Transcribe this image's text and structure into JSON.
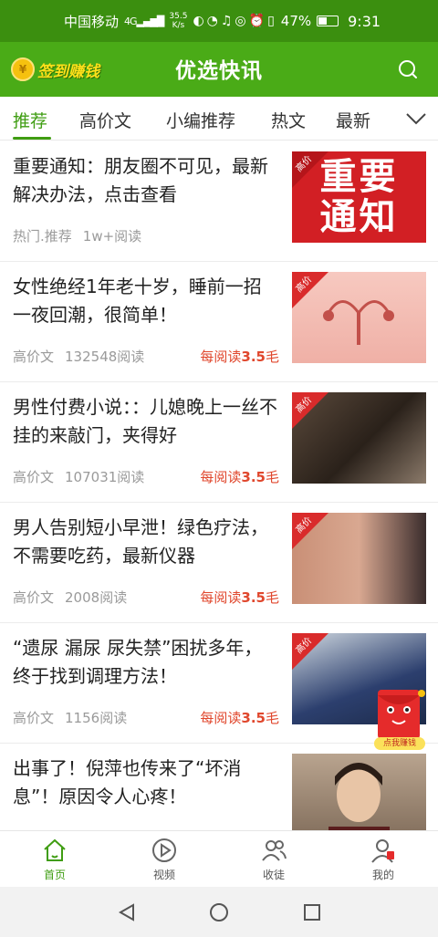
{
  "status_bar": {
    "carrier": "中国移动",
    "signal": "4G",
    "speed_value": "35.5",
    "speed_unit": "K/s",
    "battery": "47%",
    "time": "9:31"
  },
  "header": {
    "checkin_label": "签到赚钱",
    "title": "优选快讯",
    "coin_symbol": "¥"
  },
  "tabs": [
    {
      "label": "推荐",
      "active": true
    },
    {
      "label": "高价文",
      "active": false
    },
    {
      "label": "小编推荐",
      "active": false
    },
    {
      "label": "热文",
      "active": false
    },
    {
      "label": "最新",
      "active": false
    }
  ],
  "feed": [
    {
      "title": "重要通知：朋友圈不可见，最新解决办法，点击查看",
      "category": "热门.推荐",
      "reads": "1w+阅读",
      "reward_prefix": "",
      "reward_amount": "",
      "reward_suffix": "",
      "thumb_text": "重要通知",
      "badge": "高价"
    },
    {
      "title": "女性绝经1年老十岁，睡前一招一夜回潮，很简单！",
      "category": "高价文",
      "reads": "132548阅读",
      "reward_prefix": "每阅读",
      "reward_amount": "3.5",
      "reward_suffix": "毛",
      "badge": "高价"
    },
    {
      "title": "男性付费小说：：儿媳晚上一丝不挂的来敲门，夹得好",
      "category": "高价文",
      "reads": "107031阅读",
      "reward_prefix": "每阅读",
      "reward_amount": "3.5",
      "reward_suffix": "毛",
      "badge": "高价"
    },
    {
      "title": "男人告别短小早泄！绿色疗法，不需要吃药，最新仪器",
      "category": "高价文",
      "reads": "2008阅读",
      "reward_prefix": "每阅读",
      "reward_amount": "3.5",
      "reward_suffix": "毛",
      "badge": "高价"
    },
    {
      "title": "“遗尿 漏尿 尿失禁”困扰多年，终于找到调理方法！",
      "category": "高价文",
      "reads": "1156阅读",
      "reward_prefix": "每阅读",
      "reward_amount": "3.5",
      "reward_suffix": "毛",
      "badge": "高价"
    },
    {
      "title": "出事了！倪萍也传来了“坏消息”！原因令人心疼！",
      "category": "",
      "reads": "",
      "reward_prefix": "",
      "reward_amount": "",
      "reward_suffix": "",
      "badge": ""
    }
  ],
  "floating": {
    "label": "点我赚钱"
  },
  "bottom_nav": [
    {
      "label": "首页",
      "icon": "home-icon",
      "active": true
    },
    {
      "label": "视频",
      "icon": "video-icon",
      "active": false
    },
    {
      "label": "收徒",
      "icon": "apprentice-icon",
      "active": false
    },
    {
      "label": "我的",
      "icon": "profile-icon",
      "active": false
    }
  ],
  "colors": {
    "brand_green": "#4aab17",
    "accent_green": "#3f9d12",
    "reward_red": "#e0472d"
  }
}
